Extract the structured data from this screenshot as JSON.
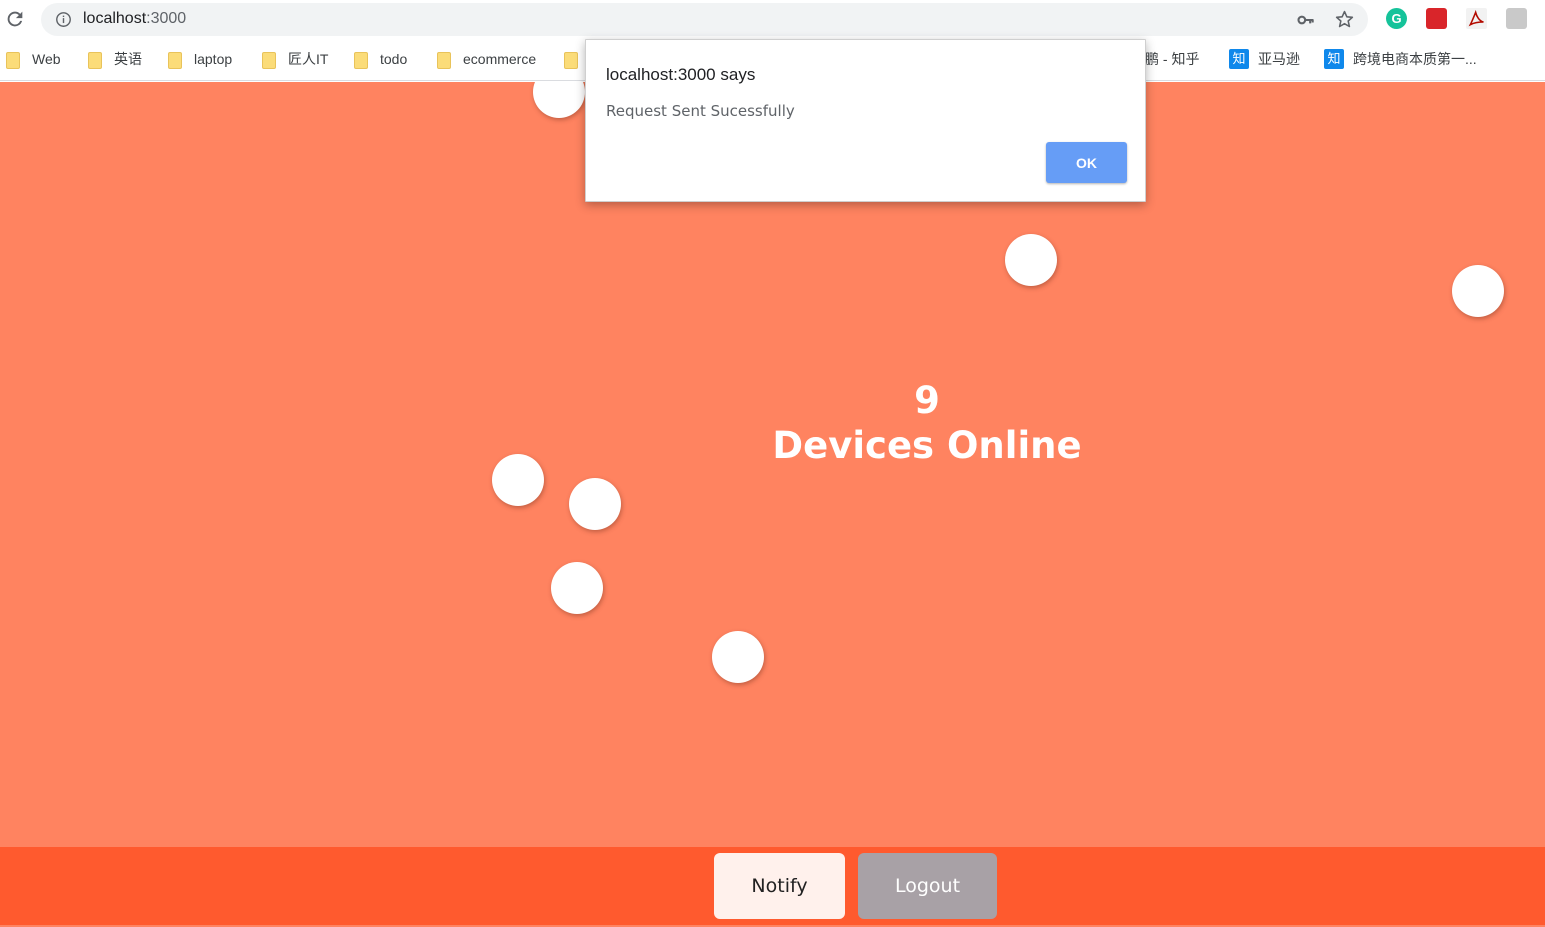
{
  "browser": {
    "url_host": "localhost",
    "url_port": ":3000",
    "bookmarks": [
      {
        "label": "Web",
        "icon": "folder-icon"
      },
      {
        "label": "英语",
        "icon": "folder-icon"
      },
      {
        "label": "laptop",
        "icon": "folder-icon"
      },
      {
        "label": "匠人IT",
        "icon": "folder-icon"
      },
      {
        "label": "todo",
        "icon": "folder-icon"
      },
      {
        "label": "ecommerce",
        "icon": "folder-icon"
      },
      {
        "label": "",
        "icon": "folder-icon"
      },
      {
        "label": "鹏 - 知乎",
        "icon": "none"
      },
      {
        "label": "亚马逊",
        "icon": "zhihu-icon",
        "icon_text": "知"
      },
      {
        "label": "跨境电商本质第一...",
        "icon": "zhihu-icon",
        "icon_text": "知"
      }
    ],
    "extensions": [
      "grammarly-icon",
      "red-extension-icon",
      "pdf-icon",
      "grey-extension-icon"
    ],
    "extension_g_text": "G"
  },
  "app": {
    "device_count": "9",
    "device_label": "Devices Online",
    "device_dot_count": 8,
    "notify_label": "Notify",
    "logout_label": "Logout",
    "colors": {
      "background": "#ff8360",
      "footer": "#ff5a2e",
      "dot": "#ffffff",
      "notify_bg": "#fff1ec",
      "logout_bg": "#a8a1a6"
    }
  },
  "dialog": {
    "title": "localhost:3000 says",
    "message": "Request Sent Sucessfully",
    "ok_label": "OK"
  }
}
